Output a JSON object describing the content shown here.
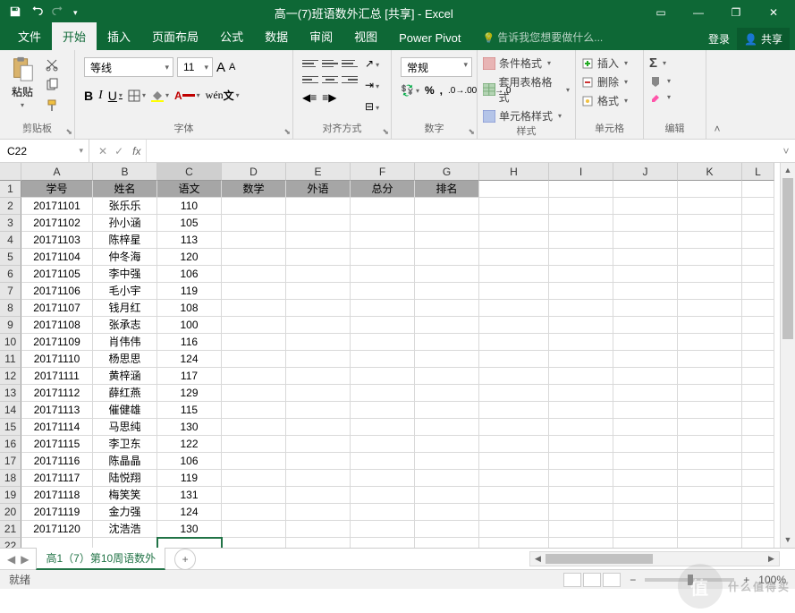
{
  "window": {
    "title": "高一(7)班语数外汇总  [共享] - Excel"
  },
  "qat": {
    "save": "save-icon",
    "undo": "undo-icon",
    "redo": "redo-icon"
  },
  "wincontrols": {
    "ribbonopts": "▭",
    "min": "—",
    "restore": "❐",
    "close": "✕"
  },
  "tabs": {
    "file": "文件",
    "home": "开始",
    "insert": "插入",
    "layout": "页面布局",
    "formulas": "公式",
    "data": "数据",
    "review": "审阅",
    "view": "视图",
    "powerpivot": "Power Pivot",
    "tellme": "告诉我您想要做什么...",
    "login": "登录",
    "share": "共享"
  },
  "ribbon": {
    "clipboard": {
      "label": "剪贴板",
      "paste": "粘贴"
    },
    "font": {
      "label": "字体",
      "name": "等线",
      "size": "11",
      "increase": "A",
      "decrease": "A"
    },
    "align": {
      "label": "对齐方式",
      "wrap": "自动换行",
      "merge": "合并后居中"
    },
    "number": {
      "label": "数字",
      "format": "常规"
    },
    "styles": {
      "label": "样式",
      "cond": "条件格式",
      "table": "套用表格格式",
      "cell": "单元格样式"
    },
    "cells": {
      "label": "单元格",
      "insert": "插入",
      "delete": "删除",
      "format": "格式"
    },
    "editing": {
      "label": "编辑"
    }
  },
  "namebox": "C22",
  "columns": [
    "A",
    "B",
    "C",
    "D",
    "E",
    "F",
    "G",
    "H",
    "I",
    "J",
    "K",
    "L"
  ],
  "headers": [
    "学号",
    "姓名",
    "语文",
    "数学",
    "外语",
    "总分",
    "排名"
  ],
  "rows": [
    {
      "r": 2,
      "id": "20171101",
      "name": "张乐乐",
      "score": "110"
    },
    {
      "r": 3,
      "id": "20171102",
      "name": "孙小涵",
      "score": "105"
    },
    {
      "r": 4,
      "id": "20171103",
      "name": "陈梓星",
      "score": "113"
    },
    {
      "r": 5,
      "id": "20171104",
      "name": "仲冬海",
      "score": "120"
    },
    {
      "r": 6,
      "id": "20171105",
      "name": "李中强",
      "score": "106"
    },
    {
      "r": 7,
      "id": "20171106",
      "name": "毛小宇",
      "score": "119"
    },
    {
      "r": 8,
      "id": "20171107",
      "name": "钱月红",
      "score": "108"
    },
    {
      "r": 9,
      "id": "20171108",
      "name": "张承志",
      "score": "100"
    },
    {
      "r": 10,
      "id": "20171109",
      "name": "肖伟伟",
      "score": "116"
    },
    {
      "r": 11,
      "id": "20171110",
      "name": "杨思思",
      "score": "124"
    },
    {
      "r": 12,
      "id": "20171111",
      "name": "黄梓涵",
      "score": "117"
    },
    {
      "r": 13,
      "id": "20171112",
      "name": "薛红燕",
      "score": "129"
    },
    {
      "r": 14,
      "id": "20171113",
      "name": "催健雄",
      "score": "115"
    },
    {
      "r": 15,
      "id": "20171114",
      "name": "马思纯",
      "score": "130"
    },
    {
      "r": 16,
      "id": "20171115",
      "name": "李卫东",
      "score": "122"
    },
    {
      "r": 17,
      "id": "20171116",
      "name": "陈晶晶",
      "score": "106"
    },
    {
      "r": 18,
      "id": "20171117",
      "name": "陆悦翔",
      "score": "119"
    },
    {
      "r": 19,
      "id": "20171118",
      "name": "梅笑笑",
      "score": "131"
    },
    {
      "r": 20,
      "id": "20171119",
      "name": "金力强",
      "score": "124"
    },
    {
      "r": 21,
      "id": "20171120",
      "name": "沈浩浩",
      "score": "130"
    }
  ],
  "activeCell": {
    "row": 22,
    "col": "C"
  },
  "sheet": {
    "name": "高1（7）第10周语数外"
  },
  "statusbar": {
    "ready": "就绪",
    "zoom": "100%"
  },
  "watermark": {
    "text": "什么值得买",
    "circ": "值"
  }
}
